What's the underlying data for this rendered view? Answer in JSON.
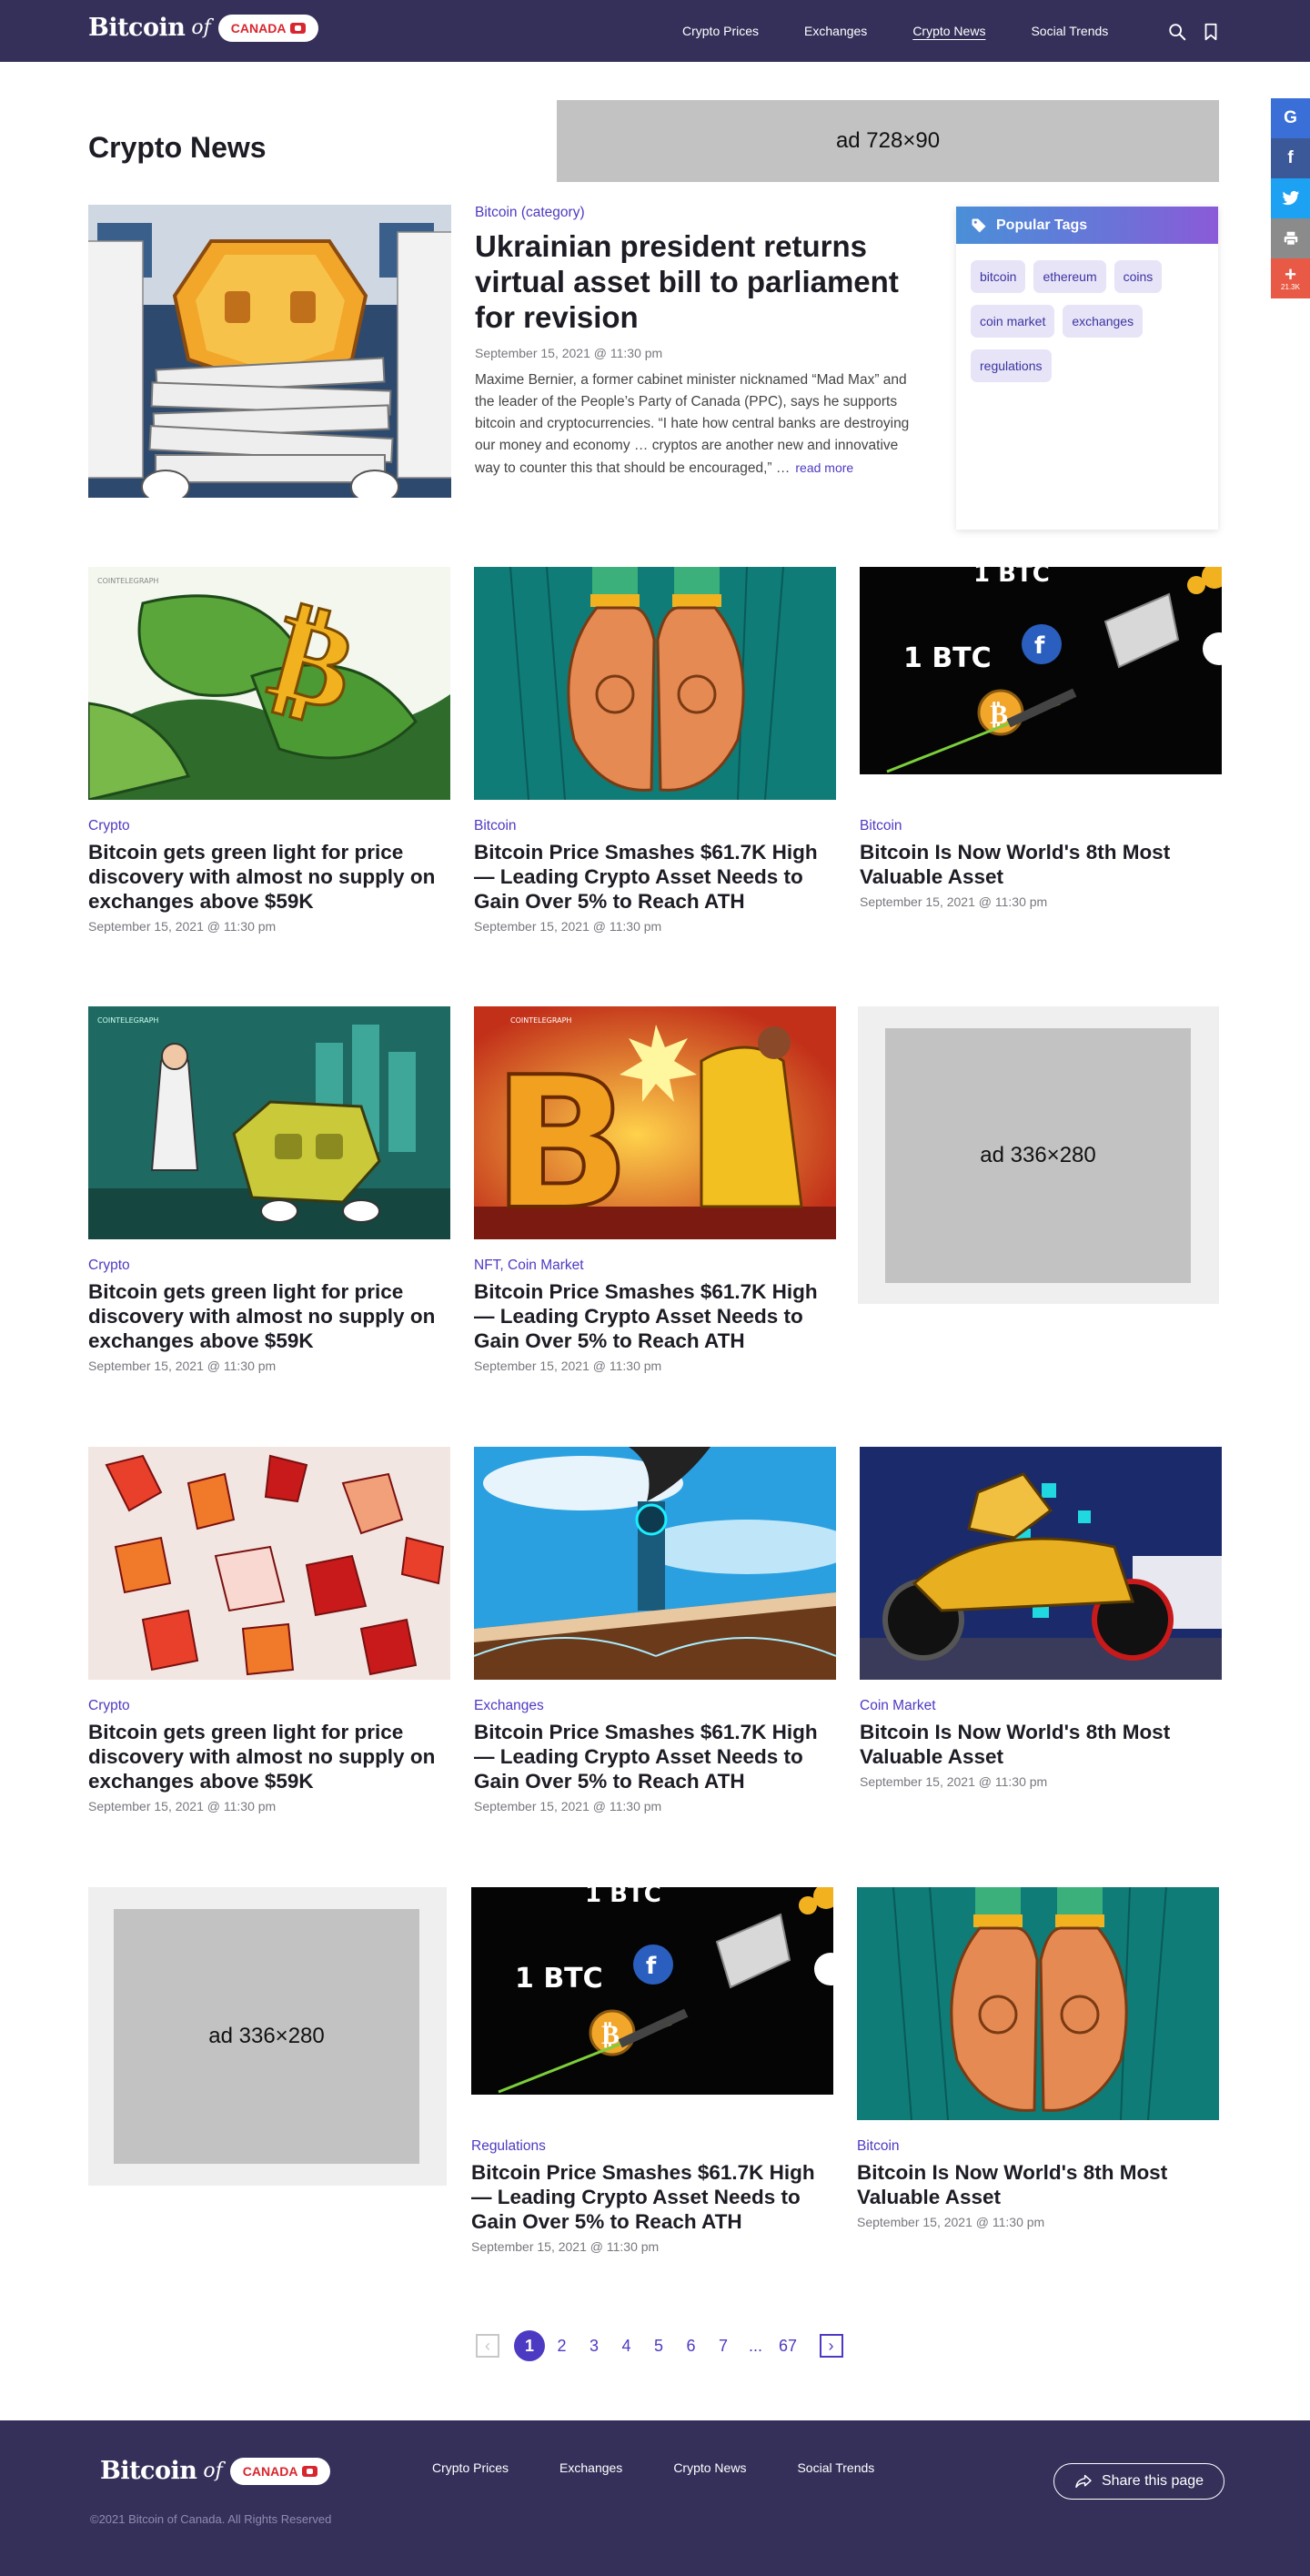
{
  "brand": {
    "name": "Bitcoin",
    "of": "of",
    "country": "CANADA"
  },
  "nav": [
    {
      "label": "Crypto Prices",
      "active": false
    },
    {
      "label": "Exchanges",
      "active": false
    },
    {
      "label": "Crypto News",
      "active": true
    },
    {
      "label": "Social Trends",
      "active": false
    }
  ],
  "header_icons": [
    "search-icon",
    "bookmark-icon"
  ],
  "social": {
    "google": "G",
    "facebook": "f",
    "twitter": "twitter-bird",
    "print": "print-icon",
    "share_plus": "+",
    "share_count": "21.3K"
  },
  "page_title": "Crypto News",
  "ads": {
    "leaderboard": "ad  728×90",
    "box1": "ad  336×280",
    "box2": "ad  336×280"
  },
  "featured": {
    "category": "Bitcoin (category)",
    "title": "Ukrainian president returns virtual asset bill to parliament for revision",
    "date": "September 15, 2021 @ 11:30 pm",
    "excerpt": "Maxime Bernier, a former cabinet minister nicknamed “Mad Max” and the leader of the People’s Party of Canada (PPC), says he supports bitcoin and cryptocurrencies. “I hate how central banks are destroying our money and economy … cryptos are another new and innovative way to counter this that should be encouraged,” …",
    "read_more": "read more"
  },
  "popular_tags": {
    "title": "Popular Tags",
    "tags": [
      "bitcoin",
      "ethereum",
      "coins",
      "coin market",
      "exchanges",
      "regulations"
    ]
  },
  "articles": [
    {
      "category": "Crypto",
      "title": "Bitcoin gets green light for price discovery with almost no supply on exchanges above $59K",
      "date": "September 15, 2021 @ 11:30 pm"
    },
    {
      "category": "Bitcoin",
      "title": "Bitcoin Price Smashes $61.7K High — Leading Crypto Asset Needs to Gain Over 5% to Reach ATH",
      "date": "September 15, 2021 @ 11:30 pm"
    },
    {
      "category": "Bitcoin",
      "title": "Bitcoin Is Now World's 8th Most Valuable Asset",
      "date": "September 15, 2021 @ 11:30 pm"
    },
    {
      "category": "Crypto",
      "title": "Bitcoin gets green light for price discovery with almost no supply on exchanges above $59K",
      "date": "September 15, 2021 @ 11:30 pm"
    },
    {
      "category": "NFT, Coin Market",
      "title": "Bitcoin Price Smashes $61.7K High — Leading Crypto Asset Needs to Gain Over 5% to Reach ATH",
      "date": "September 15, 2021 @ 11:30 pm"
    },
    {
      "category": "Crypto",
      "title": "Bitcoin gets green light for price discovery with almost no supply on exchanges above $59K",
      "date": "September 15, 2021 @ 11:30 pm"
    },
    {
      "category": "Exchanges",
      "title": "Bitcoin Price Smashes $61.7K High — Leading Crypto Asset Needs to Gain Over 5% to Reach ATH",
      "date": "September 15, 2021 @ 11:30 pm"
    },
    {
      "category": "Coin Market",
      "title": "Bitcoin Is Now World's 8th Most Valuable Asset",
      "date": "September 15, 2021 @ 11:30 pm"
    },
    {
      "category": "Regulations",
      "title": "Bitcoin Price Smashes $61.7K High — Leading Crypto Asset Needs to Gain Over 5% to Reach ATH",
      "date": "September 15, 2021 @ 11:30 pm"
    },
    {
      "category": "Bitcoin",
      "title": "Bitcoin Is Now World's 8th Most Valuable Asset",
      "date": "September 15, 2021 @ 11:30 pm"
    }
  ],
  "image_text": {
    "btc": "1 BTC",
    "watermark": "COINTELEGRAPH"
  },
  "pagination": {
    "pages": [
      "1",
      "2",
      "3",
      "4",
      "5",
      "6",
      "7",
      "...",
      "67"
    ],
    "current": "1",
    "prev": "‹",
    "next": "›"
  },
  "footer": {
    "nav": [
      "Crypto Prices",
      "Exchanges",
      "Crypto News",
      "Social Trends"
    ],
    "share": "Share this page",
    "copyright": "©2021 Bitcoin of Canada. All Rights Reserved"
  },
  "colors": {
    "header_bg": "#35305a",
    "accent": "#4d3ac2",
    "tag_bg": "#e6e4f6",
    "ad_gray": "#c2c2c2",
    "brand_red": "#d8262e"
  }
}
